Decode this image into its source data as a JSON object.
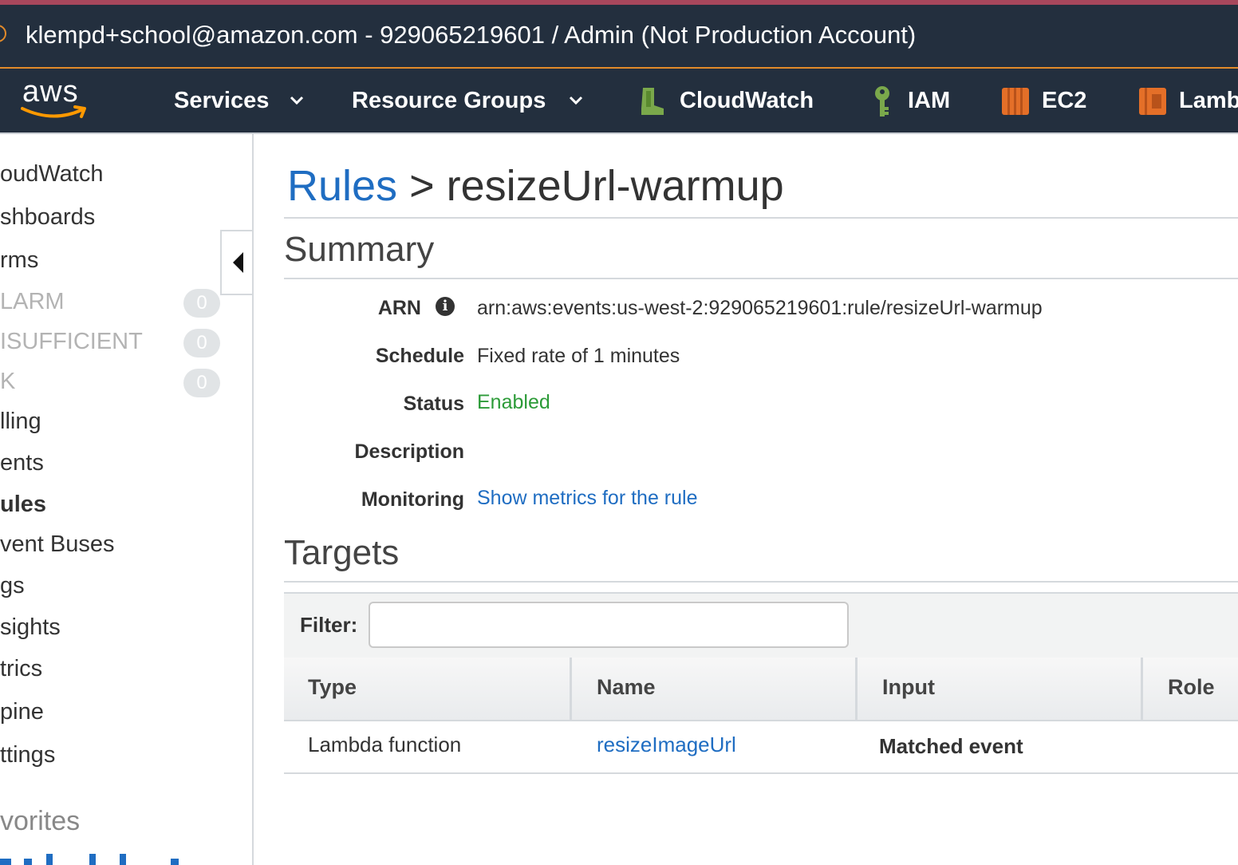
{
  "account_bar": {
    "text": "klempd+school@amazon.com - 929065219601 / Admin (Not Production Account)"
  },
  "nav": {
    "logo_text": "aws",
    "services_label": "Services",
    "resource_groups_label": "Resource Groups",
    "shortcuts": [
      {
        "label": "CloudWatch",
        "icon": "cloudwatch-icon"
      },
      {
        "label": "IAM",
        "icon": "iam-key-icon"
      },
      {
        "label": "EC2",
        "icon": "ec2-icon"
      },
      {
        "label": "Lamb",
        "icon": "lambda-icon"
      }
    ]
  },
  "sidebar": {
    "items": [
      {
        "label": "oudWatch"
      },
      {
        "label": "shboards"
      },
      {
        "label": "rms"
      },
      {
        "label": "LARM",
        "count": "0"
      },
      {
        "label": "ISUFFICIENT",
        "count": "0"
      },
      {
        "label": "K",
        "count": "0"
      },
      {
        "label": "lling"
      },
      {
        "label": "ents"
      },
      {
        "label": "ules"
      },
      {
        "label": "vent Buses"
      },
      {
        "label": "gs"
      },
      {
        "label": "sights"
      },
      {
        "label": "trics"
      },
      {
        "label": "pine"
      },
      {
        "label": "ttings"
      }
    ],
    "favorites_label": "vorites"
  },
  "page": {
    "breadcrumb_link": "Rules",
    "separator": ">",
    "rule_name": "resizeUrl-warmup"
  },
  "summary": {
    "title": "Summary",
    "arn_label": "ARN",
    "arn_value": "arn:aws:events:us-west-2:929065219601:rule/resizeUrl-warmup",
    "schedule_label": "Schedule",
    "schedule_value": "Fixed rate of 1 minutes",
    "status_label": "Status",
    "status_value": "Enabled",
    "description_label": "Description",
    "description_value": "",
    "monitoring_label": "Monitoring",
    "monitoring_link": "Show metrics for the rule"
  },
  "targets": {
    "title": "Targets",
    "filter_label": "Filter:",
    "filter_value": "",
    "columns": [
      "Type",
      "Name",
      "Input",
      "Role"
    ],
    "rows": [
      {
        "type": "Lambda function",
        "name": "resizeImageUrl",
        "input": "Matched event",
        "role": ""
      }
    ]
  },
  "colors": {
    "header_bg": "#232f3e",
    "accent_orange": "#e28a2a",
    "link_blue": "#1f6dc2",
    "status_green": "#2c9b38"
  }
}
